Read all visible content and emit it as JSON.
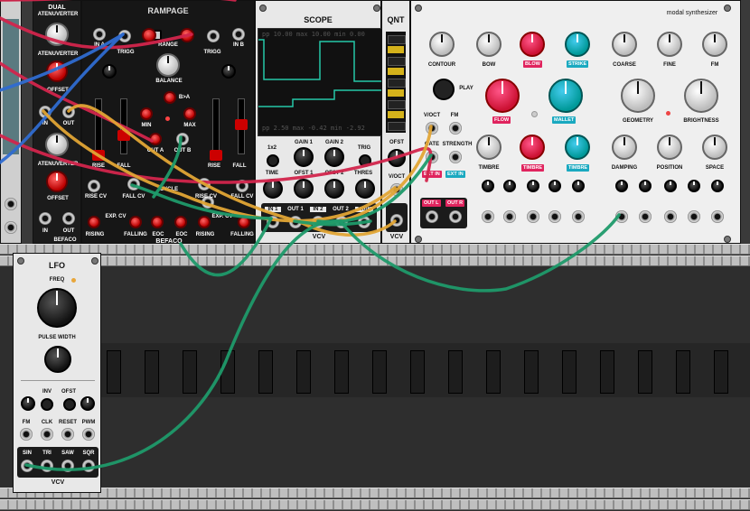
{
  "modules": {
    "dual_atenuverter": {
      "title": "DUAL",
      "knob1": "ATENUVERTER",
      "atenuverter1": "ATENUVERTER",
      "offset1": "OFFSET",
      "atenuverter2": "ATENUVERTER",
      "offset2": "OFFSET",
      "in_label": "IN",
      "out_label": "OUT",
      "brand": "BEFACO"
    },
    "rampage": {
      "title": "RAMPAGE",
      "in_a": "IN A",
      "in_b": "IN B",
      "range": "RANGE",
      "trigg": "TRIGG",
      "balance": "BALANCE",
      "b_gt_a": "B>A",
      "min": "MIN",
      "max": "MAX",
      "out_a": "OUT A",
      "out_b": "OUT B",
      "rise": "RISE",
      "fall": "FALL",
      "rise_cv": "RISE CV",
      "fall_cv": "FALL CV",
      "exp_cv": "EXP. CV",
      "cycle": "CYCLE",
      "rising": "RISING",
      "falling": "FALLING",
      "eoc": "EOC",
      "brand": "BEFACO"
    },
    "scope": {
      "title": "SCOPE",
      "top_left": "pp",
      "top_vals": "10.00  max 10.00  min  0.00",
      "bot_left": "pp",
      "bot_vals": "2.50  max -0.42  min -2.92",
      "x2": "1x2",
      "gain1": "GAIN 1",
      "gain2": "GAIN 2",
      "trig": "TRIG",
      "time": "TIME",
      "ofst1": "OFST 1",
      "ofst2": "OFST 2",
      "thres": "THRES",
      "in1": "IN 1",
      "out1": "OUT 1",
      "in2": "IN 2",
      "out2": "OUT 2",
      "trig_jack": "TRIG",
      "brand": "VCV"
    },
    "qnt": {
      "title": "QNT",
      "ofst": "OFST",
      "voct": "V/OCT",
      "brand": "VCV"
    },
    "modal": {
      "title": "modal synthesizer",
      "contour": "CONTOUR",
      "bow": "BOW",
      "blow": "BLOW",
      "strike": "STRIKE",
      "coarse": "COARSE",
      "fine": "FINE",
      "fm": "FM",
      "play": "PLAY",
      "flow": "FLOW",
      "mallet": "MALLET",
      "geometry": "GEOMETRY",
      "brightness": "BRIGHTNESS",
      "voct": "V/OCT",
      "fm2": "FM",
      "gate": "GATE",
      "strength": "STRENGTH",
      "timbre1": "TIMBRE",
      "timbre2": "TIMBRE",
      "timbre3": "TIMBRE",
      "damping": "DAMPING",
      "position": "POSITION",
      "space": "SPACE",
      "ext_in1": "EXT IN",
      "ext_in2": "EXT IN",
      "out_l": "OUT L",
      "out_r": "OUT R"
    },
    "lfo": {
      "title": "LFO",
      "freq": "FREQ",
      "pulse_width": "PULSE WIDTH",
      "inv": "INV",
      "ofst": "OFST",
      "fm": "FM",
      "clk": "CLK",
      "reset": "RESET",
      "pwm": "PWM",
      "sin": "SIN",
      "tri": "TRI",
      "saw": "SAW",
      "sqr": "SQR",
      "brand": "VCV"
    }
  },
  "colors": {
    "cable_red": "#d2254c",
    "cable_blue": "#2f6bd0",
    "cable_green": "#1f9a6a",
    "cable_orange": "#e2a535",
    "accent_pink": "#e0245e",
    "accent_cyan": "#1aa9c0",
    "scope_trace": "#26c7a8"
  }
}
